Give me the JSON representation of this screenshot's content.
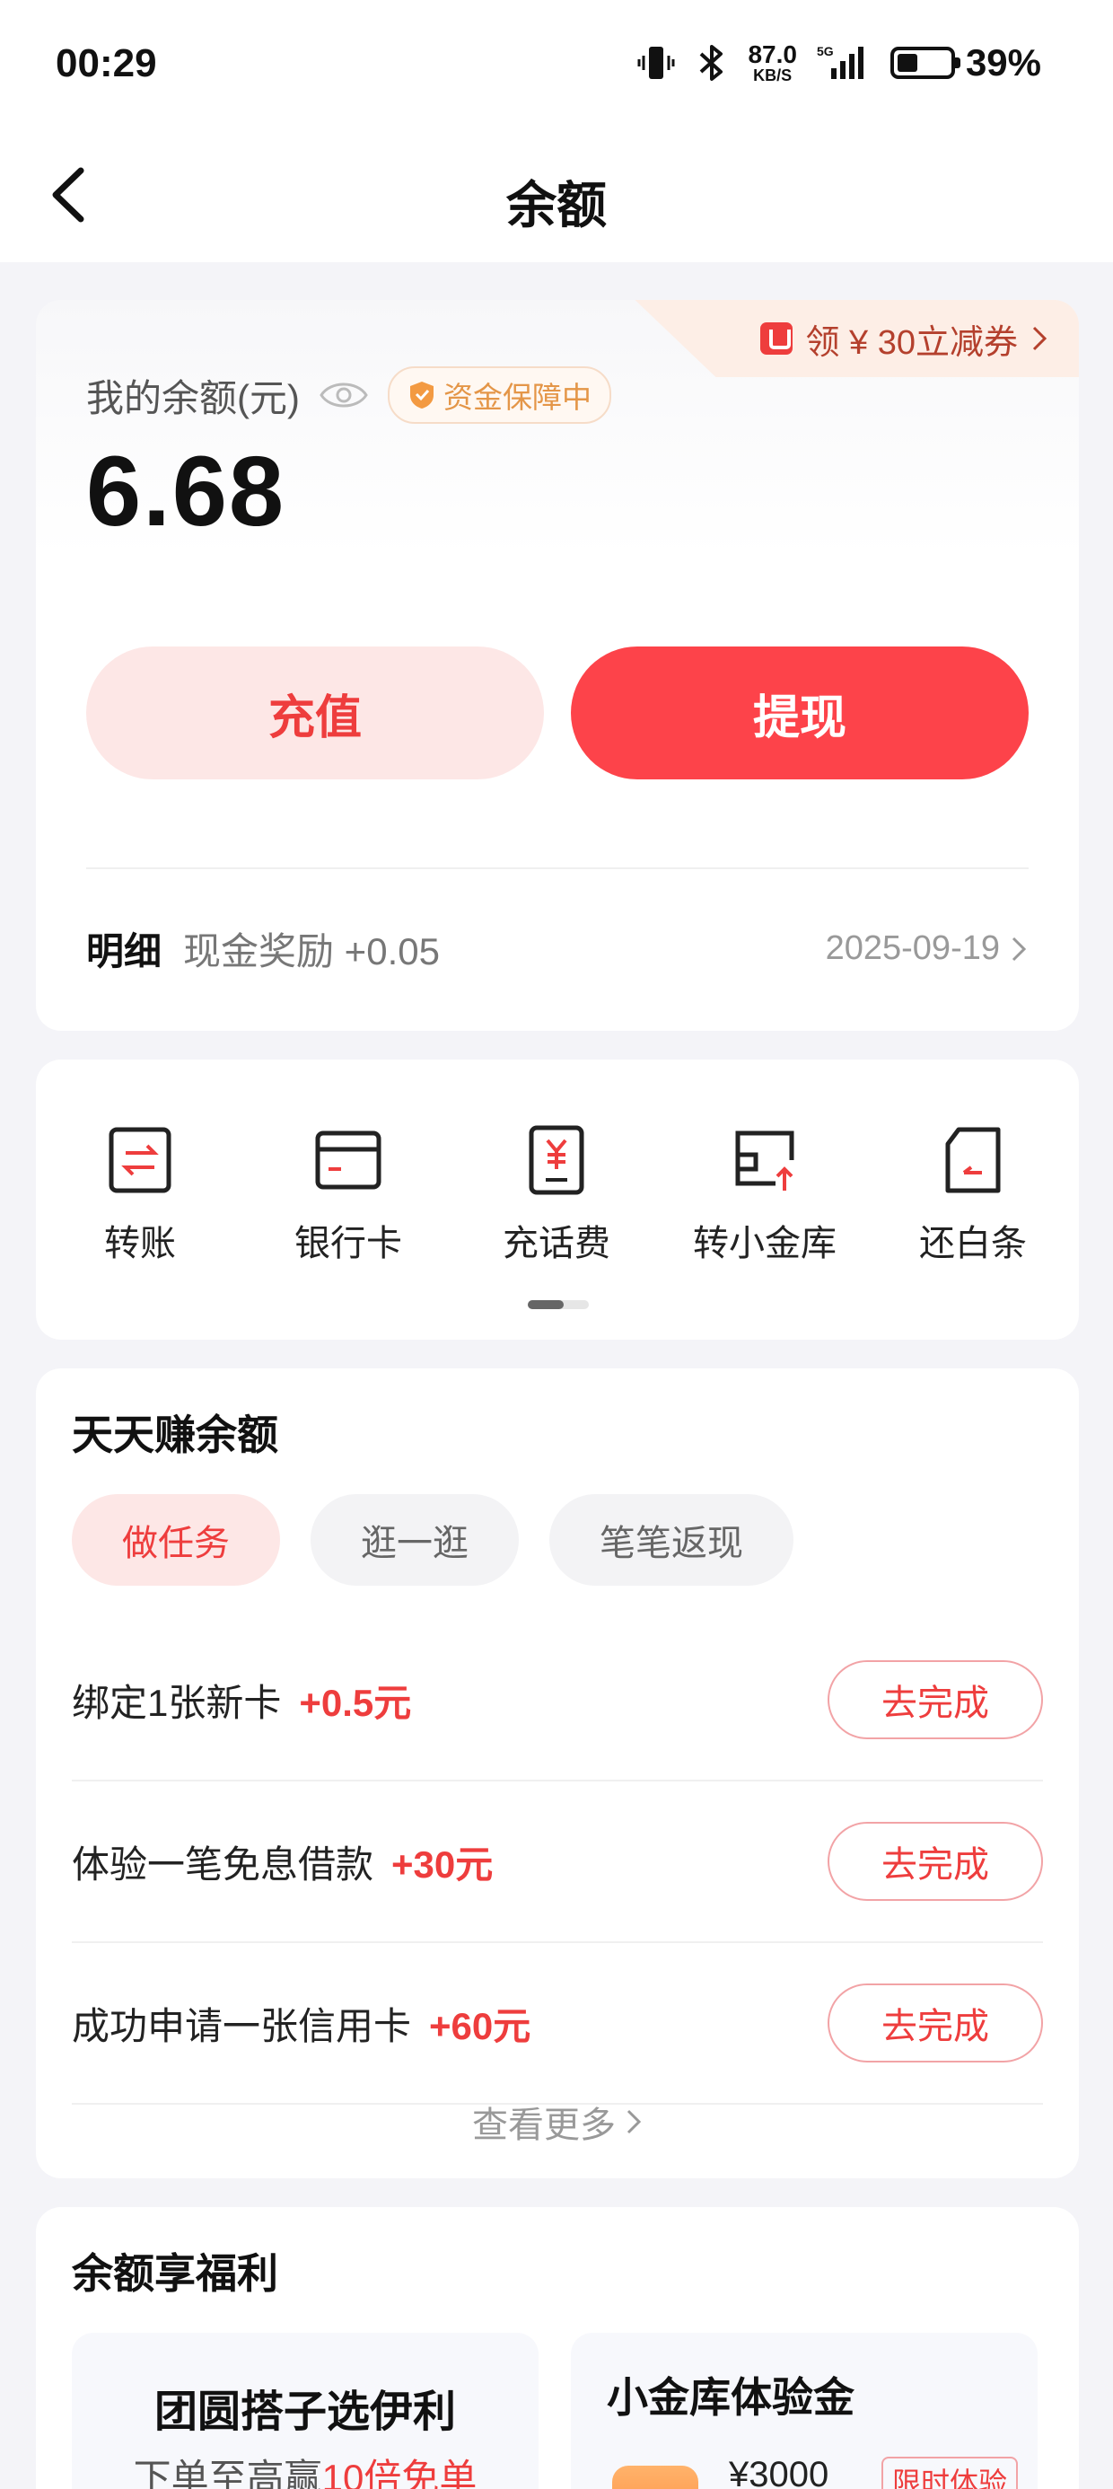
{
  "status_bar": {
    "time": "00:29",
    "net_speed_value": "87.0",
    "net_speed_unit": "KB/S",
    "network": "5G",
    "battery_percent": "39%",
    "battery_level": 0.39
  },
  "header": {
    "title": "余额"
  },
  "balance": {
    "coupon_label": "领 ¥ 30立减券",
    "label": "我的余额(元)",
    "guarantee_badge": "资金保障中",
    "amount": "6.68",
    "recharge_label": "充值",
    "withdraw_label": "提现",
    "detail_label": "明细",
    "detail_text": "现金奖励 +0.05",
    "detail_date": "2025-09-19"
  },
  "shortcuts": [
    {
      "label": "转账",
      "icon": "transfer-icon"
    },
    {
      "label": "银行卡",
      "icon": "bank-card-icon"
    },
    {
      "label": "充话费",
      "icon": "phone-recharge-icon"
    },
    {
      "label": "转小金库",
      "icon": "vault-transfer-icon"
    },
    {
      "label": "还白条",
      "icon": "repay-icon"
    }
  ],
  "tasks": {
    "title": "天天赚余额",
    "tabs": [
      "做任务",
      "逛一逛",
      "笔笔返现"
    ],
    "active_tab": 0,
    "items": [
      {
        "name": "绑定1张新卡",
        "reward": "+0.5元",
        "button": "去完成"
      },
      {
        "name": "体验一笔免息借款",
        "reward": "+30元",
        "button": "去完成"
      },
      {
        "name": "成功申请一张信用卡",
        "reward": "+60元",
        "button": "去完成"
      }
    ],
    "more_label": "查看更多"
  },
  "benefits": {
    "title": "余额享福利",
    "left": {
      "title": "团圆搭子选伊利",
      "sub_prefix": "下单至高赢",
      "sub_highlight": "10倍免单"
    },
    "right": {
      "title": "小金库体验金",
      "amount": "¥3000",
      "tag": "限时体验"
    }
  },
  "colors": {
    "accent": "#ee3d3d",
    "button_red": "#fd434a",
    "soft_red": "#fde7e6",
    "page_bg": "#f4f4f8"
  }
}
